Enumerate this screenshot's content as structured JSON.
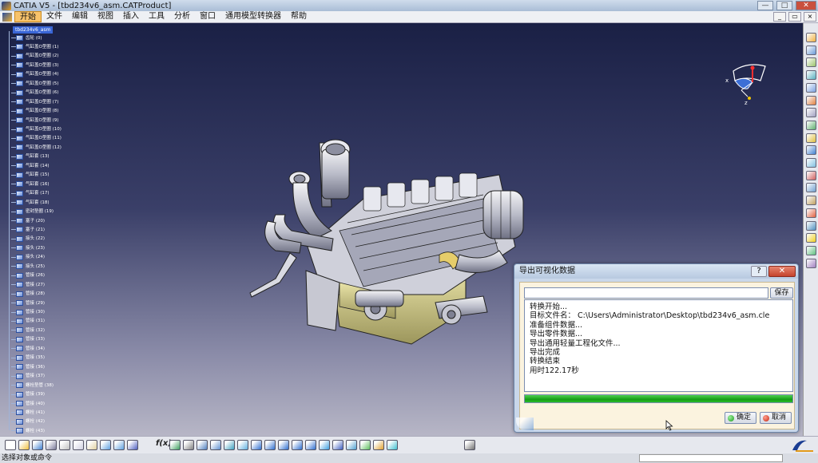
{
  "window": {
    "title": "CATIA V5 - [tbd234v6_asm.CATProduct]",
    "buttons": {
      "minimize": "—",
      "maximize": "□",
      "close": "✕"
    }
  },
  "menu": {
    "items": [
      "开始",
      "文件",
      "编辑",
      "视图",
      "插入",
      "工具",
      "分析",
      "窗口",
      "通用模型转换器",
      "帮助"
    ],
    "active": "开始"
  },
  "tree": {
    "root": "tbd234v6_asm",
    "items": [
      "齿轮 (0)",
      "气缸盖O型圈 (1)",
      "气缸盖O型圈 (2)",
      "气缸盖O型圈 (3)",
      "气缸盖O型圈 (4)",
      "气缸盖O型圈 (5)",
      "气缸盖O型圈 (6)",
      "气缸盖O型圈 (7)",
      "气缸盖O型圈 (8)",
      "气缸盖O型圈 (9)",
      "气缸盖O型圈 (10)",
      "气缸盖O型圈 (11)",
      "气缸盖O型圈 (12)",
      "气缸套 (13)",
      "气缸套 (14)",
      "气缸套 (15)",
      "气缸套 (16)",
      "气缸套 (17)",
      "气缸套 (18)",
      "密封垫圈 (19)",
      "塞子 (20)",
      "塞子 (21)",
      "接头 (22)",
      "接头 (23)",
      "接头 (24)",
      "接头 (25)",
      "管接 (26)",
      "管接 (27)",
      "管接 (28)",
      "管接 (29)",
      "管接 (30)",
      "管接 (31)",
      "管接 (32)",
      "管接 (33)",
      "管接 (34)",
      "管接 (35)",
      "管接 (36)",
      "管接 (37)",
      "螺栓垫管 (38)",
      "管接 (39)",
      "管接 (40)",
      "螺栓 (41)",
      "螺栓 (42)",
      "螺栓 (43)"
    ]
  },
  "dialog": {
    "title": "导出可视化数据",
    "help": "?",
    "close": "✕",
    "path_value": "",
    "save_label": "保存",
    "log": [
      "转换开始...",
      "目标文件名： C:\\Users\\Administrator\\Desktop\\tbd234v6_asm.cle",
      "准备组件数据...",
      "导出零件数据...",
      "导出通用轻量工程化文件...",
      "导出完成",
      "转换结束",
      "用时122.17秒"
    ],
    "progress": 1.0,
    "ok_label": "确定",
    "cancel_label": "取消"
  },
  "toolbar": {
    "formula_label": "f(x)"
  },
  "status": {
    "prompt": "选择对象或命令",
    "command_value": ""
  },
  "icons": {
    "right_toolbar": [
      "pointer-icon",
      "assembly-icon",
      "product-icon",
      "component-icon",
      "part-icon",
      "replace-icon",
      "graph-icon",
      "reorder-icon",
      "multi-instance-icon",
      "catalog-icon",
      "fast-multi-instance-icon",
      "constraint-icon",
      "manipulate-icon",
      "snap-icon",
      "explode-icon",
      "measure-icon",
      "bulb-icon",
      "update-icon",
      "scenes-icon"
    ],
    "bottom_toolbar": [
      "new-icon",
      "open-icon",
      "save-icon",
      "print-icon",
      "cut-icon",
      "copy-icon",
      "paste-icon",
      "undo-icon",
      "redo-icon",
      "whats-this-icon",
      "formula-icon",
      "knowledge-icon",
      "photo-icon",
      "table-icon",
      "tree-icon",
      "compass-icon",
      "fly-mode-icon",
      "fit-all-icon",
      "pan-icon",
      "rotate-icon",
      "zoom-in-icon",
      "zoom-out-icon",
      "normal-view-icon",
      "iso-view-icon",
      "multi-view-icon",
      "shading-icon",
      "hide-show-icon",
      "swap-visible-icon",
      "camera-icon"
    ]
  },
  "colors": {
    "accent": "#f8c36a",
    "progress": "#22a822",
    "viewport_top": "#1a2045",
    "viewport_bottom": "#b7b6c6"
  }
}
